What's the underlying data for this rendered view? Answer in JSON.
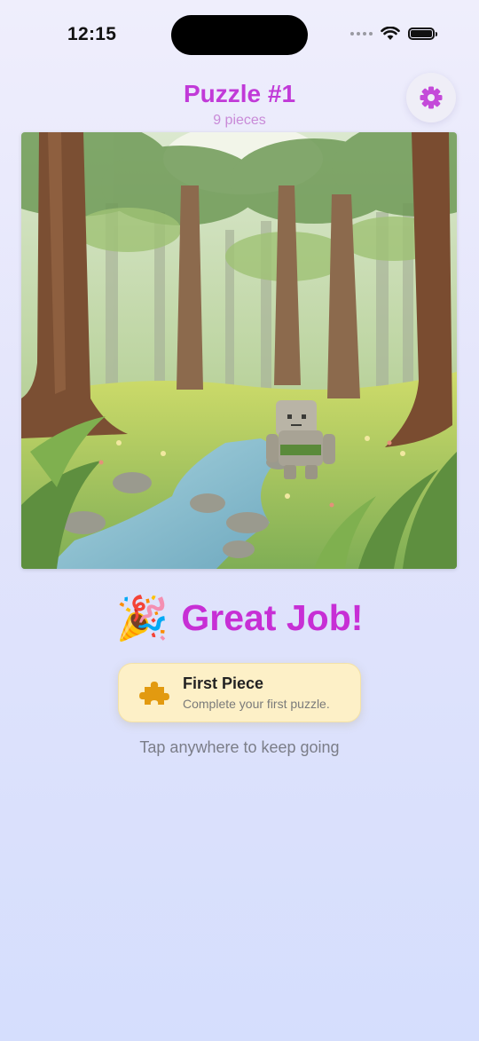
{
  "status_bar": {
    "time": "12:15"
  },
  "header": {
    "title": "Puzzle #1",
    "subtitle": "9 pieces"
  },
  "settings": {
    "icon": "gear-icon"
  },
  "puzzle": {
    "image_icon": "forest-golem-illustration"
  },
  "celebration": {
    "emoji": "🎉",
    "message": "Great Job!"
  },
  "achievement": {
    "icon": "puzzle-piece-icon",
    "title": "First Piece",
    "description": "Complete your first puzzle."
  },
  "hint": "Tap anywhere to keep going",
  "colors": {
    "accent": "#c13ad8",
    "badge_bg": "#fdf0c7",
    "piece": "#e29a10"
  }
}
